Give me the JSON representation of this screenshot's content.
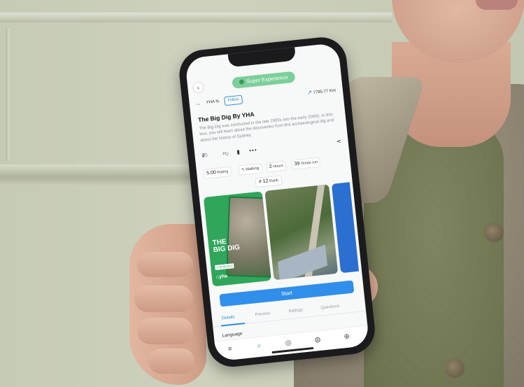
{
  "app": {
    "badge": "Super Experience",
    "author": "YHA N.",
    "follow_label": "Follow",
    "distance": "7795.77 Km",
    "title": "The Big Dig By YHA",
    "description": "The Big Dig was conducted in the late 1900s into the early 2000s. In this tour, you will learn about the discoveries from this archaeological dig and about the history of Sydney.",
    "likes": "7",
    "stats": [
      {
        "value": "5.00",
        "label": "Rating"
      },
      {
        "value": "",
        "label": "Walking"
      },
      {
        "value": "2",
        "label": "Hours"
      },
      {
        "value": "39",
        "label": "Times run"
      }
    ],
    "rank": {
      "value": "# 12",
      "label": "Rank"
    },
    "image_text": {
      "headline_1": "THE",
      "headline_2": "BIG DIG",
      "tag": "THE ROCKS",
      "brand": "yha"
    },
    "start_label": "Start",
    "tabs": [
      "Details",
      "Preview",
      "Ratings",
      "Questions"
    ],
    "section_heading": "Language",
    "nav": [
      {
        "icon": "menu-icon"
      },
      {
        "icon": "search-icon"
      },
      {
        "icon": "location-icon"
      },
      {
        "icon": "globe-icon"
      },
      {
        "icon": "plus-circle-icon"
      }
    ]
  },
  "colors": {
    "accent_blue": "#2f8fea",
    "badge_green": "#7ccf9a",
    "brand_green": "#2fa65a"
  }
}
